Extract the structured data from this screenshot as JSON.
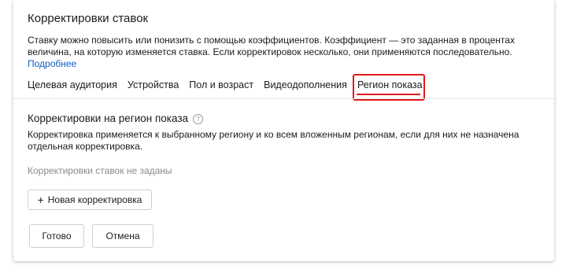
{
  "panel": {
    "title": "Корректировки ставок",
    "description": "Ставку можно повысить или понизить с помощью коэффициентов. Коэффициент — это заданная в процентах величина, на которую изменяется ставка. Если корректировок несколько, они применяются последовательно.",
    "more_link": "Подробнее"
  },
  "tabs": [
    {
      "label": "Целевая аудитория"
    },
    {
      "label": "Устройства"
    },
    {
      "label": "Пол и возраст"
    },
    {
      "label": "Видеодополнения"
    },
    {
      "label": "Регион показа",
      "active": true
    }
  ],
  "section": {
    "title": "Корректировки на регион показа",
    "help_icon": "help-question-icon",
    "description": "Корректировка применяется к выбранному региону и ко всем вложенным регионам, если для них не назначена отдельная корректировка.",
    "empty_note": "Корректировки ставок не заданы"
  },
  "buttons": {
    "new_adjustment_icon": "+",
    "new_adjustment": "Новая корректировка",
    "done": "Готово",
    "cancel": "Отмена"
  },
  "colors": {
    "link": "#0a5ec8",
    "highlight": "#e41919"
  }
}
